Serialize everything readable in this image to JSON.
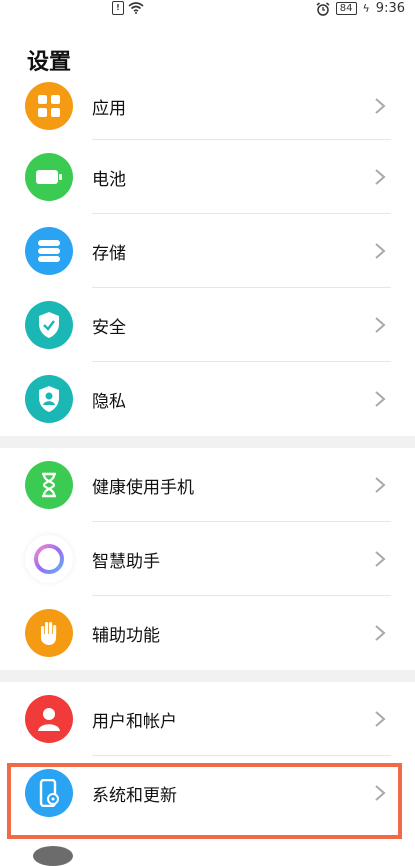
{
  "status_bar": {
    "battery": "84",
    "time": "9:36"
  },
  "page": {
    "title": "设置"
  },
  "groups": [
    {
      "items": [
        {
          "label": "应用",
          "icon": "apps-grid-icon",
          "color": "#f59a13"
        },
        {
          "label": "电池",
          "icon": "battery-icon",
          "color": "#3ccb52"
        },
        {
          "label": "存储",
          "icon": "storage-icon",
          "color": "#2aa3f2"
        },
        {
          "label": "安全",
          "icon": "shield-check-icon",
          "color": "#1ab7b4"
        },
        {
          "label": "隐私",
          "icon": "privacy-icon",
          "color": "#1ab7b4"
        }
      ]
    },
    {
      "items": [
        {
          "label": "健康使用手机",
          "icon": "hourglass-icon",
          "color": "#3ccb52"
        },
        {
          "label": "智慧助手",
          "icon": "assistant-ring-icon",
          "color": "#ffffff"
        },
        {
          "label": "辅助功能",
          "icon": "hand-icon",
          "color": "#f59a13"
        }
      ]
    },
    {
      "items": [
        {
          "label": "用户和帐户",
          "icon": "user-icon",
          "color": "#f13b3b"
        },
        {
          "label": "系统和更新",
          "icon": "phone-gear-icon",
          "color": "#2aa3f2"
        }
      ]
    }
  ],
  "highlight_color": "#f06a45"
}
